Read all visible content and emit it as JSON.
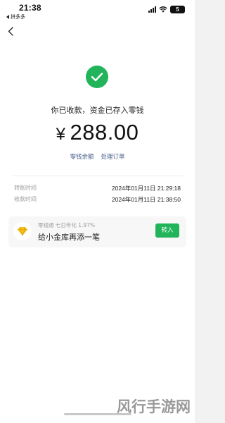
{
  "status_bar": {
    "time": "21:38",
    "back_app_label": "拼多多",
    "battery_label": "5"
  },
  "icons": {
    "back": "chevron-left-icon",
    "success": "checkmark-circle-icon",
    "promo": "diamond-icon",
    "signal": "signal-icon",
    "wifi": "wifi-icon"
  },
  "colors": {
    "accent_green": "#21b45a",
    "link_blue": "#4a5f8c"
  },
  "result": {
    "message": "你已收款，资金已存入零钱",
    "currency": "¥",
    "amount": "288.00"
  },
  "links": {
    "balance": "零钱余额",
    "order": "处理订单"
  },
  "details": [
    {
      "label": "转账时间",
      "value": "2024年01月11日 21:29:18"
    },
    {
      "label": "收款时间",
      "value": "2024年01月11日 21:38:50"
    }
  ],
  "promo": {
    "subtitle": "零钱通 七日年化 1.97%",
    "title": "给小金库再添一笔",
    "button": "转入"
  },
  "watermark": "风行手游网"
}
